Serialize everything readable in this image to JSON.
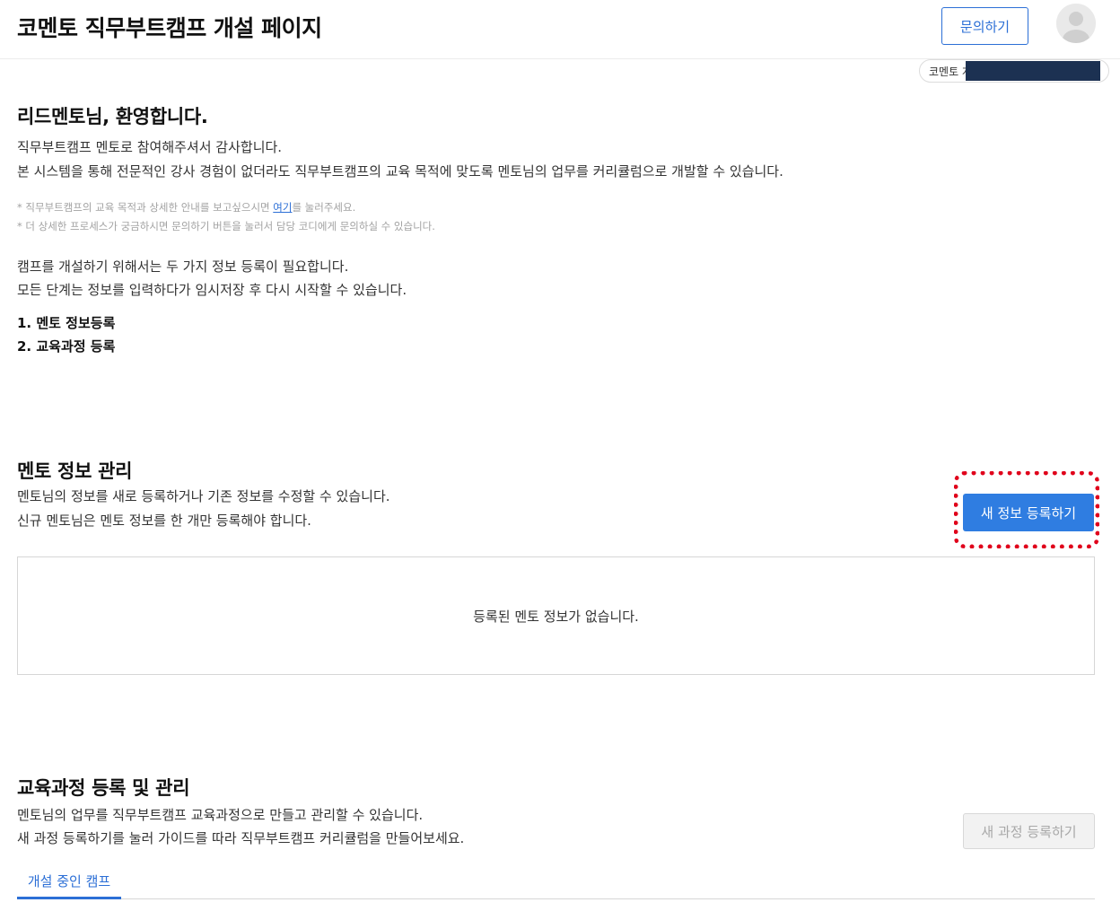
{
  "header": {
    "title": "코멘토 직무부트캠프 개설 페이지",
    "contact_label": "문의하기",
    "account_label": "코멘토 계정:"
  },
  "welcome": {
    "title": "리드멘토님, 환영합니다.",
    "line1": "직무부트캠프 멘토로 참여해주셔서 감사합니다.",
    "line2": "본 시스템을 통해 전문적인 강사 경험이 없더라도 직무부트캠프의 교육 목적에 맞도록 멘토님의 업무를 커리큘럼으로 개발할 수 있습니다.",
    "note1_prefix": "* 직무부트캠프의 교육 목적과 상세한 안내를 보고싶으시면 ",
    "note1_link": "여기",
    "note1_suffix": "를 눌러주세요.",
    "note2": "* 더 상세한 프로세스가 궁금하시면 문의하기 버튼을 눌러서 담당 코디에게 문의하실 수 있습니다.",
    "info1": "캠프를 개설하기 위해서는 두 가지 정보 등록이 필요합니다.",
    "info2": "모든 단계는 정보를 입력하다가 임시저장 후 다시 시작할 수 있습니다.",
    "steps": [
      "1. 멘토 정보등록",
      "2. 교육과정 등록"
    ]
  },
  "mentor_section": {
    "title": "멘토 정보 관리",
    "desc1": "멘토님의 정보를 새로 등록하거나 기존 정보를 수정할 수 있습니다.",
    "desc2": "신규 멘토님은 멘토 정보를 한 개만 등록해야 합니다.",
    "register_button": "새 정보 등록하기",
    "empty_message": "등록된 멘토 정보가 없습니다."
  },
  "course_section": {
    "title": "교육과정 등록 및 관리",
    "desc1": "멘토님의 업무를 직무부트캠프 교육과정으로 만들고 관리할 수 있습니다.",
    "desc2": "새 과정 등록하기를 눌러 가이드를 따라 직무부트캠프 커리큘럼을 만들어보세요.",
    "register_button": "새 과정 등록하기",
    "tabs": [
      "개설 중인 캠프"
    ]
  },
  "colors": {
    "primary": "#2f7de1",
    "highlight": "#e0001b",
    "masked_account": "#1c3152"
  }
}
